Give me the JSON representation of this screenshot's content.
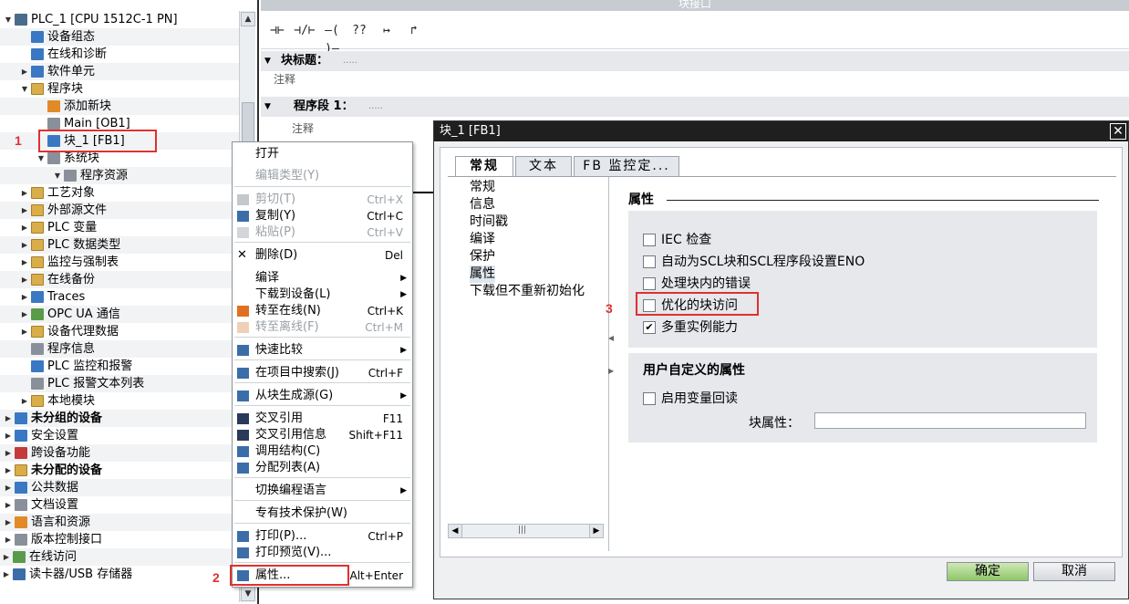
{
  "tree": {
    "items": [
      {
        "label": "PLC_1 [CPU 1512C-1 PN]",
        "arrow": "▼",
        "icon": "cpu-icon",
        "bold": false
      },
      {
        "label": "设备组态",
        "arrow": "",
        "icon": "device-config-icon",
        "bold": false
      },
      {
        "label": "在线和诊断",
        "arrow": "",
        "icon": "online-diagnostics-icon",
        "bold": false
      },
      {
        "label": "软件单元",
        "arrow": "▶",
        "icon": "software-units-icon",
        "bold": false
      },
      {
        "label": "程序块",
        "arrow": "▼",
        "icon": "folder-icon",
        "bold": false
      },
      {
        "label": "添加新块",
        "arrow": "",
        "icon": "add-block-icon",
        "bold": false
      },
      {
        "label": "Main [OB1]",
        "arrow": "",
        "icon": "ob-block-icon",
        "bold": false
      },
      {
        "label": "块_1 [FB1]",
        "arrow": "",
        "icon": "fb-block-icon",
        "bold": false
      },
      {
        "label": "系统块",
        "arrow": "▼",
        "icon": "folder-icon",
        "bold": false
      },
      {
        "label": "程序资源",
        "arrow": "▼",
        "icon": "folder-icon",
        "bold": false
      },
      {
        "label": "工艺对象",
        "arrow": "▶",
        "icon": "folder-icon",
        "bold": false
      },
      {
        "label": "外部源文件",
        "arrow": "▶",
        "icon": "folder-icon",
        "bold": false
      },
      {
        "label": "PLC 变量",
        "arrow": "▶",
        "icon": "folder-icon",
        "bold": false
      },
      {
        "label": "PLC 数据类型",
        "arrow": "▶",
        "icon": "folder-icon",
        "bold": false
      },
      {
        "label": "监控与强制表",
        "arrow": "▶",
        "icon": "folder-icon",
        "bold": false
      },
      {
        "label": "在线备份",
        "arrow": "▶",
        "icon": "folder-icon",
        "bold": false
      },
      {
        "label": "Traces",
        "arrow": "▶",
        "icon": "folder-icon",
        "bold": false
      },
      {
        "label": "OPC UA 通信",
        "arrow": "▶",
        "icon": "folder-icon",
        "bold": false
      },
      {
        "label": "设备代理数据",
        "arrow": "▶",
        "icon": "folder-icon",
        "bold": false
      },
      {
        "label": "程序信息",
        "arrow": "",
        "icon": "program-info-icon",
        "bold": false
      },
      {
        "label": "PLC 监控和报警",
        "arrow": "",
        "icon": "plc-alarm-icon",
        "bold": false
      },
      {
        "label": "PLC 报警文本列表",
        "arrow": "",
        "icon": "alarm-text-icon",
        "bold": false
      },
      {
        "label": "本地模块",
        "arrow": "▶",
        "icon": "folder-icon",
        "bold": false
      },
      {
        "label": "未分组的设备",
        "arrow": "▶",
        "icon": "ungrouped-devices-icon",
        "bold": true
      },
      {
        "label": "安全设置",
        "arrow": "▶",
        "icon": "security-icon",
        "bold": false
      },
      {
        "label": "跨设备功能",
        "arrow": "▶",
        "icon": "cross-device-icon",
        "bold": false
      },
      {
        "label": "未分配的设备",
        "arrow": "▶",
        "icon": "unassigned-devices-icon",
        "bold": true
      },
      {
        "label": "公共数据",
        "arrow": "▶",
        "icon": "common-data-icon",
        "bold": false
      },
      {
        "label": "文档设置",
        "arrow": "▶",
        "icon": "document-settings-icon",
        "bold": false
      },
      {
        "label": "语言和资源",
        "arrow": "▶",
        "icon": "languages-icon",
        "bold": false
      },
      {
        "label": "版本控制接口",
        "arrow": "▶",
        "icon": "version-control-icon",
        "bold": false
      },
      {
        "label": "在线访问",
        "arrow": "▶",
        "icon": "online-access-icon",
        "bold": false
      },
      {
        "label": "读卡器/USB 存储器",
        "arrow": "▶",
        "icon": "card-reader-icon",
        "bold": false
      }
    ]
  },
  "annotations": {
    "step1": "1",
    "step2": "2",
    "step3": "3"
  },
  "editor": {
    "interface_title": "块接口",
    "lad_buttons": [
      "⊣⊢",
      "⊣/⊢",
      "–( )–",
      "??",
      "↦",
      "↱"
    ],
    "block_title_label": "块标题：",
    "block_title_dots": ".....",
    "block_comment": "注释",
    "network_label": "程序段 1：",
    "network_dots": ".....",
    "network_comment": "注释"
  },
  "context_menu": {
    "items": [
      {
        "label": "打开",
        "shortcut": "",
        "submenu": false,
        "disabled": false,
        "icon": ""
      },
      {
        "label": "编辑类型(Y)",
        "shortcut": "",
        "submenu": false,
        "disabled": true,
        "icon": ""
      },
      {
        "label": "剪切(T)",
        "shortcut": "Ctrl+X",
        "submenu": false,
        "disabled": true,
        "icon": "cut-icon"
      },
      {
        "label": "复制(Y)",
        "shortcut": "Ctrl+C",
        "submenu": false,
        "disabled": false,
        "icon": "copy-icon"
      },
      {
        "label": "粘贴(P)",
        "shortcut": "Ctrl+V",
        "submenu": false,
        "disabled": true,
        "icon": "paste-icon"
      },
      {
        "label": "删除(D)",
        "shortcut": "Del",
        "submenu": false,
        "disabled": false,
        "icon": "delete-icon"
      },
      {
        "label": "编译",
        "shortcut": "",
        "submenu": true,
        "disabled": false,
        "icon": ""
      },
      {
        "label": "下载到设备(L)",
        "shortcut": "",
        "submenu": true,
        "disabled": false,
        "icon": ""
      },
      {
        "label": "转至在线(N)",
        "shortcut": "Ctrl+K",
        "submenu": false,
        "disabled": false,
        "icon": "go-online-icon"
      },
      {
        "label": "转至离线(F)",
        "shortcut": "Ctrl+M",
        "submenu": false,
        "disabled": true,
        "icon": "go-offline-icon"
      },
      {
        "label": "快速比较",
        "shortcut": "",
        "submenu": true,
        "disabled": false,
        "icon": "compare-icon"
      },
      {
        "label": "在项目中搜索(J)",
        "shortcut": "Ctrl+F",
        "submenu": false,
        "disabled": false,
        "icon": "search-icon"
      },
      {
        "label": "从块生成源(G)",
        "shortcut": "",
        "submenu": true,
        "disabled": false,
        "icon": "generate-source-icon"
      },
      {
        "label": "交叉引用",
        "shortcut": "F11",
        "submenu": false,
        "disabled": false,
        "icon": "cross-reference-icon"
      },
      {
        "label": "交叉引用信息",
        "shortcut": "Shift+F11",
        "submenu": false,
        "disabled": false,
        "icon": "cross-reference-info-icon"
      },
      {
        "label": "调用结构(C)",
        "shortcut": "",
        "submenu": false,
        "disabled": false,
        "icon": "call-structure-icon"
      },
      {
        "label": "分配列表(A)",
        "shortcut": "",
        "submenu": false,
        "disabled": false,
        "icon": "assignment-list-icon"
      },
      {
        "label": "切换编程语言",
        "shortcut": "",
        "submenu": true,
        "disabled": false,
        "icon": ""
      },
      {
        "label": "专有技术保护(W)",
        "shortcut": "",
        "submenu": false,
        "disabled": false,
        "icon": ""
      },
      {
        "label": "打印(P)...",
        "shortcut": "Ctrl+P",
        "submenu": false,
        "disabled": false,
        "icon": "print-icon"
      },
      {
        "label": "打印预览(V)...",
        "shortcut": "",
        "submenu": false,
        "disabled": false,
        "icon": "print-preview-icon"
      },
      {
        "label": "属性...",
        "shortcut": "Alt+Enter",
        "submenu": false,
        "disabled": false,
        "icon": "properties-icon"
      }
    ]
  },
  "dialog": {
    "title": "块_1 [FB1]",
    "close": "✕",
    "tabs": [
      "常规",
      "文本",
      "FB 监控定..."
    ],
    "nav": [
      "常规",
      "信息",
      "时间戳",
      "编译",
      "保护",
      "属性",
      "下载但不重新初始化"
    ],
    "nav_selected": "属性",
    "section_title": "属性",
    "options": [
      {
        "label": "IEC 检查",
        "checked": false
      },
      {
        "label": "自动为SCL块和SCL程序段设置ENO",
        "checked": false
      },
      {
        "label": "处理块内的错误",
        "checked": false
      },
      {
        "label": "优化的块访问",
        "checked": false
      },
      {
        "label": "多重实例能力",
        "checked": true
      }
    ],
    "user_group_title": "用户自定义的属性",
    "enable_readback_label": "启用变量回读",
    "enable_readback_checked": false,
    "block_attr_label": "块属性：",
    "block_attr_value": "",
    "ok": "确定",
    "cancel": "取消"
  }
}
